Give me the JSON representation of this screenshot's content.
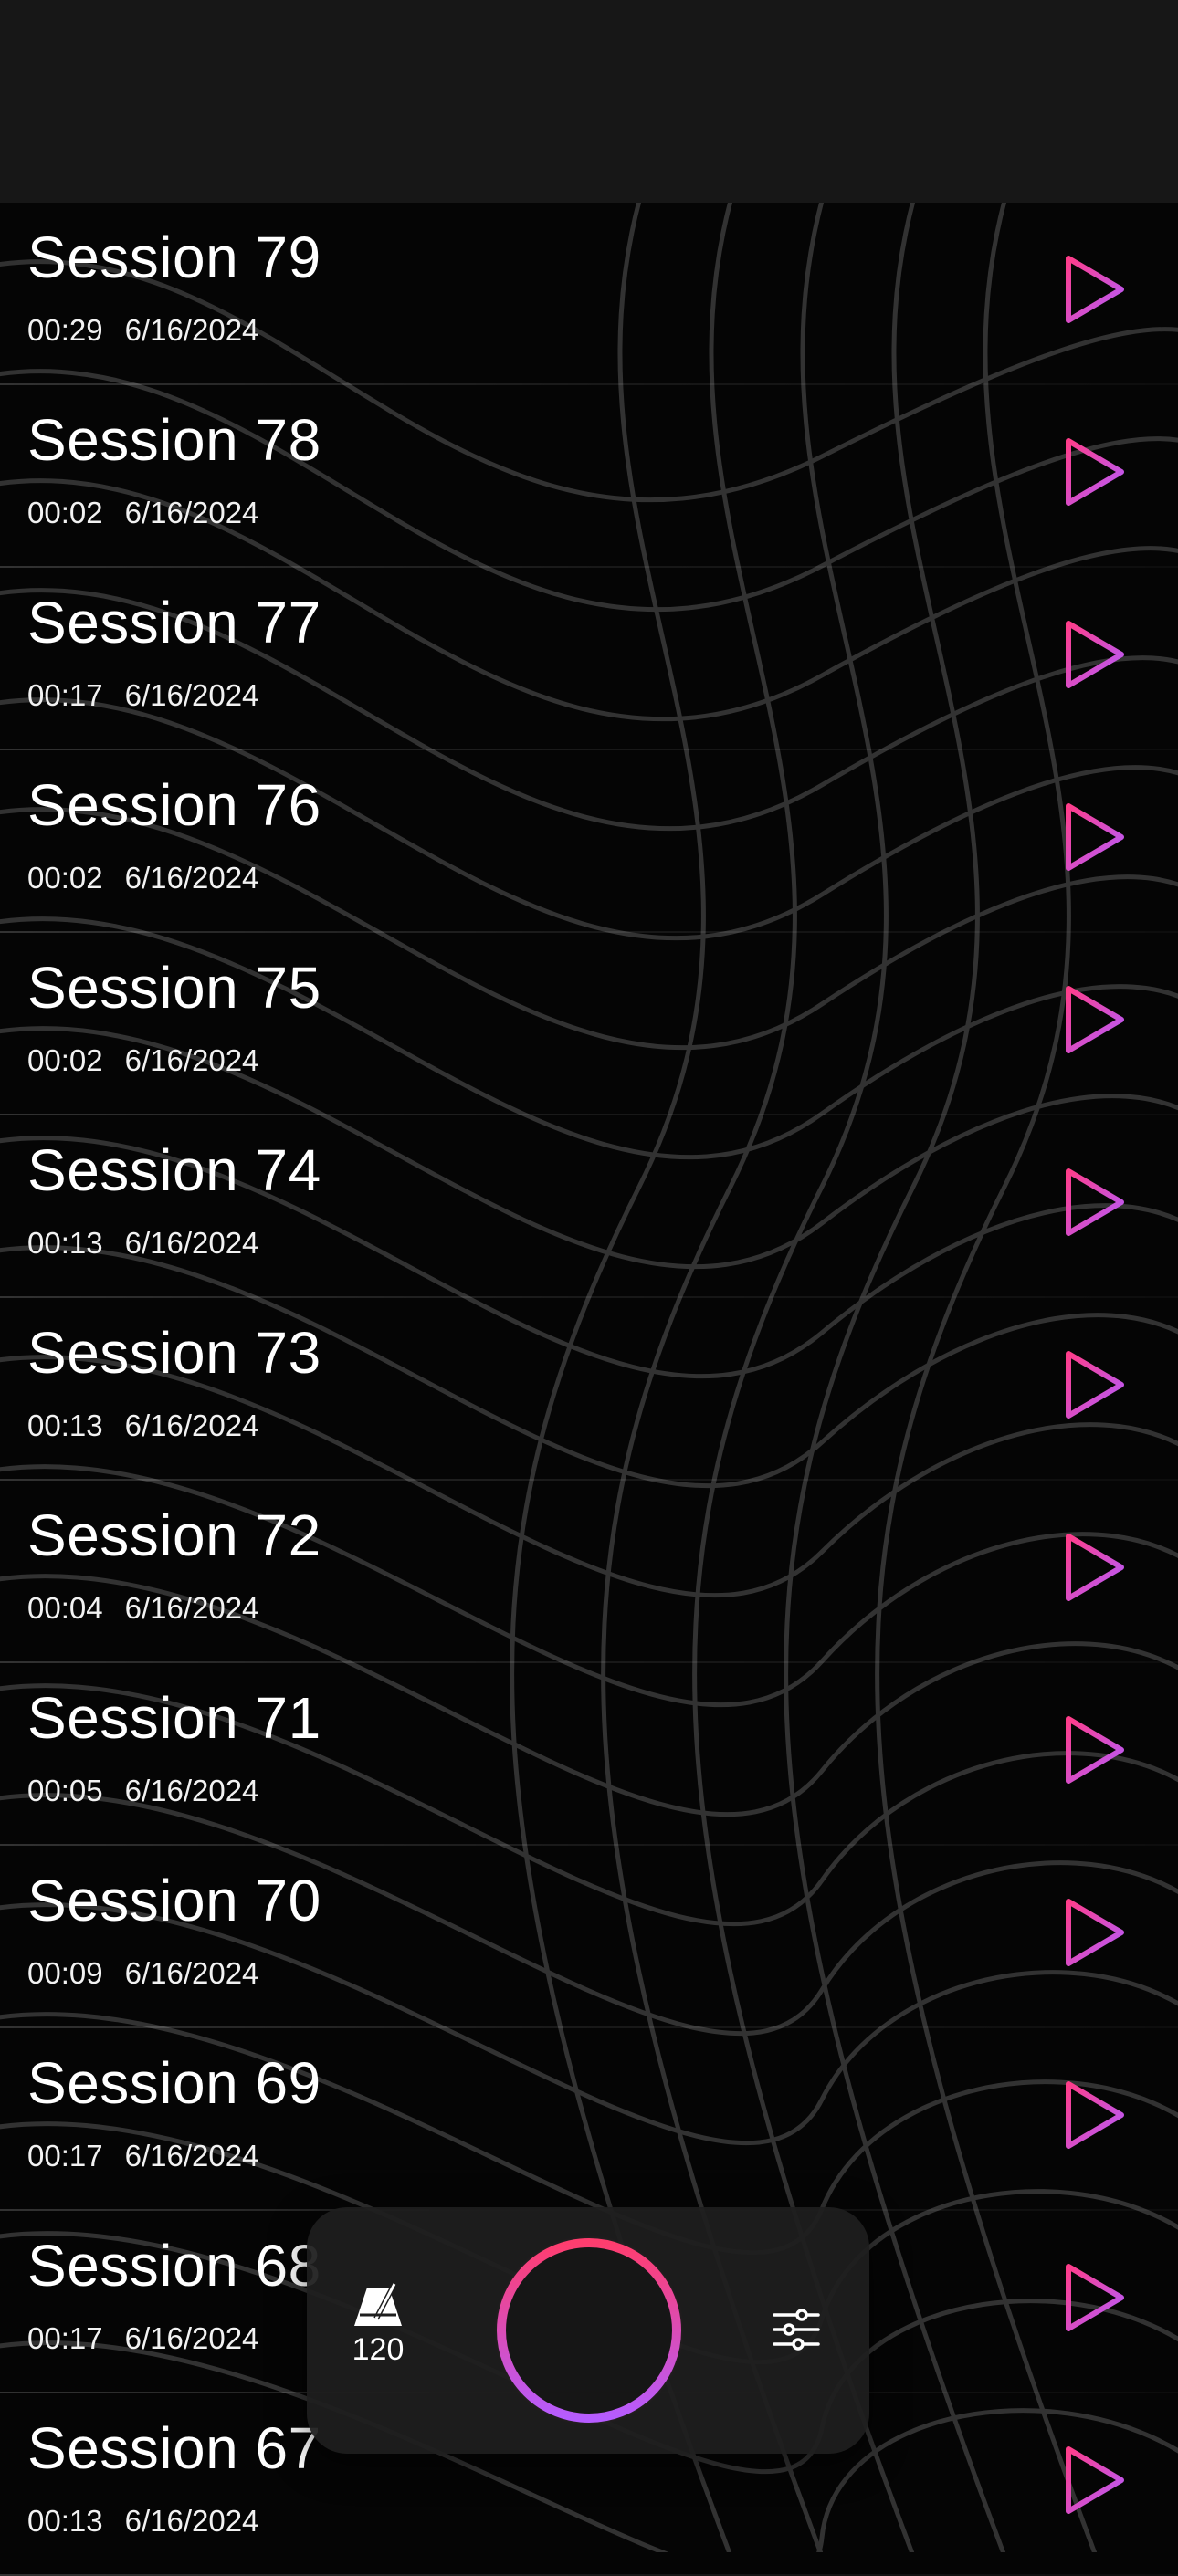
{
  "sessions": [
    {
      "title": "Session 79",
      "duration": "00:29",
      "date": "6/16/2024"
    },
    {
      "title": "Session 78",
      "duration": "00:02",
      "date": "6/16/2024"
    },
    {
      "title": "Session 77",
      "duration": "00:17",
      "date": "6/16/2024"
    },
    {
      "title": "Session 76",
      "duration": "00:02",
      "date": "6/16/2024"
    },
    {
      "title": "Session 75",
      "duration": "00:02",
      "date": "6/16/2024"
    },
    {
      "title": "Session 74",
      "duration": "00:13",
      "date": "6/16/2024"
    },
    {
      "title": "Session 73",
      "duration": "00:13",
      "date": "6/16/2024"
    },
    {
      "title": "Session 72",
      "duration": "00:04",
      "date": "6/16/2024"
    },
    {
      "title": "Session 71",
      "duration": "00:05",
      "date": "6/16/2024"
    },
    {
      "title": "Session 70",
      "duration": "00:09",
      "date": "6/16/2024"
    },
    {
      "title": "Session 69",
      "duration": "00:17",
      "date": "6/16/2024"
    },
    {
      "title": "Session 68",
      "duration": "00:17",
      "date": "6/16/2024"
    },
    {
      "title": "Session 67",
      "duration": "00:13",
      "date": "6/16/2024"
    }
  ],
  "play_icon": "play-icon",
  "dock": {
    "metronome_icon": "metronome-icon",
    "tempo": "120",
    "record_icon": "record-button",
    "settings_icon": "sliders-icon"
  },
  "colors": {
    "accent_pink": "#ff3d8a",
    "accent_purple": "#b45cff",
    "background": "#050505",
    "topbar": "#171717"
  }
}
